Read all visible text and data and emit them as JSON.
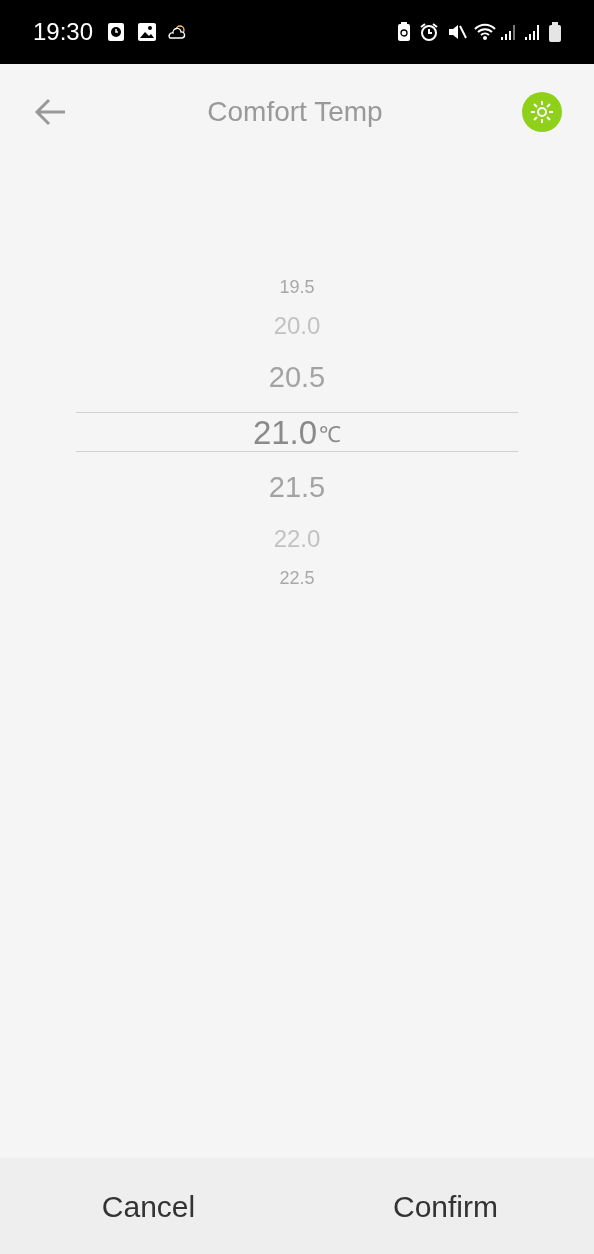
{
  "status_bar": {
    "time": "19:30"
  },
  "header": {
    "title": "Comfort Temp"
  },
  "picker": {
    "unit": "℃",
    "items": [
      {
        "value": "19.5",
        "selected": false
      },
      {
        "value": "20.0",
        "selected": false
      },
      {
        "value": "20.5",
        "selected": false
      },
      {
        "value": "21.0",
        "selected": true
      },
      {
        "value": "21.5",
        "selected": false
      },
      {
        "value": "22.0",
        "selected": false
      },
      {
        "value": "22.5",
        "selected": false
      }
    ]
  },
  "buttons": [
    {
      "label": "Cancel"
    },
    {
      "label": "Confirm"
    }
  ]
}
